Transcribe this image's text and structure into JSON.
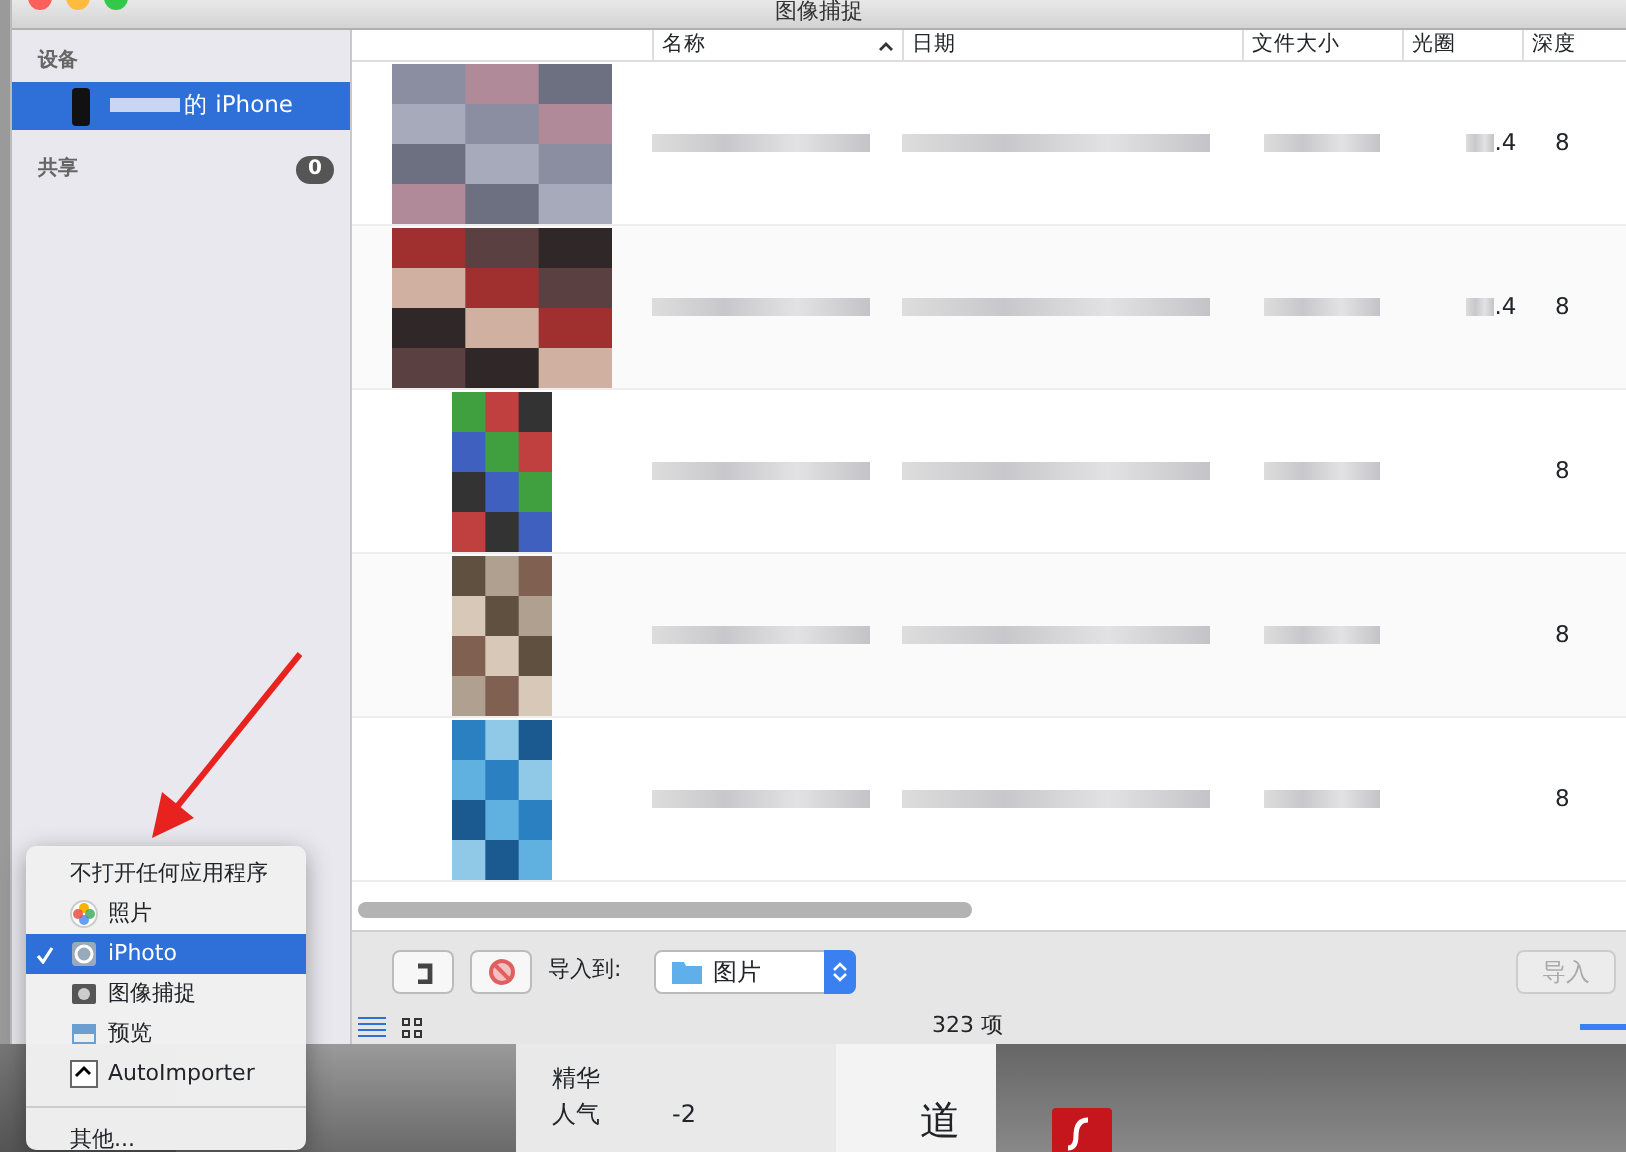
{
  "window": {
    "title": "图像捕捉"
  },
  "sidebar": {
    "sections": [
      {
        "heading": "设备",
        "items": [
          {
            "label": "的 iPhone",
            "selected": true
          }
        ]
      },
      {
        "heading": "共享",
        "badge": "0"
      }
    ]
  },
  "table": {
    "columns": [
      {
        "label": "名称",
        "sorted": true
      },
      {
        "label": "日期",
        "sorted": false
      },
      {
        "label": "文件大小",
        "sorted": false
      },
      {
        "label": "光圈",
        "sorted": false
      },
      {
        "label": "深度",
        "sorted": false
      }
    ],
    "rows": [
      {
        "aperture": ".4",
        "depth": "8"
      },
      {
        "aperture": ".4",
        "depth": "8"
      },
      {
        "depth": "8"
      },
      {
        "depth": "8"
      },
      {
        "depth": "8"
      }
    ]
  },
  "toolbar": {
    "import_to_label": "导入到:",
    "destination": "图片",
    "import_button": {
      "label": "导入",
      "disabled": true
    }
  },
  "status_bar": {
    "count": "323 项",
    "zoom_slider": {
      "level": 1
    }
  },
  "menu": {
    "items": [
      {
        "kind": "header",
        "label": "不打开任何应用程序"
      },
      {
        "kind": "app",
        "label": "照片",
        "selected": false
      },
      {
        "kind": "app",
        "label": "iPhoto",
        "selected": true
      },
      {
        "kind": "app",
        "label": "图像捕捉",
        "selected": false
      },
      {
        "kind": "app",
        "label": "预览",
        "selected": false
      },
      {
        "kind": "app",
        "label": "AutoImporter",
        "selected": false
      },
      {
        "kind": "separator"
      },
      {
        "kind": "other",
        "label": "其他...",
        "selected": false
      }
    ]
  },
  "background": {
    "rows": [
      {
        "label": "精华"
      },
      {
        "label": "人气",
        "value": "-2"
      }
    ],
    "heading": "道"
  }
}
